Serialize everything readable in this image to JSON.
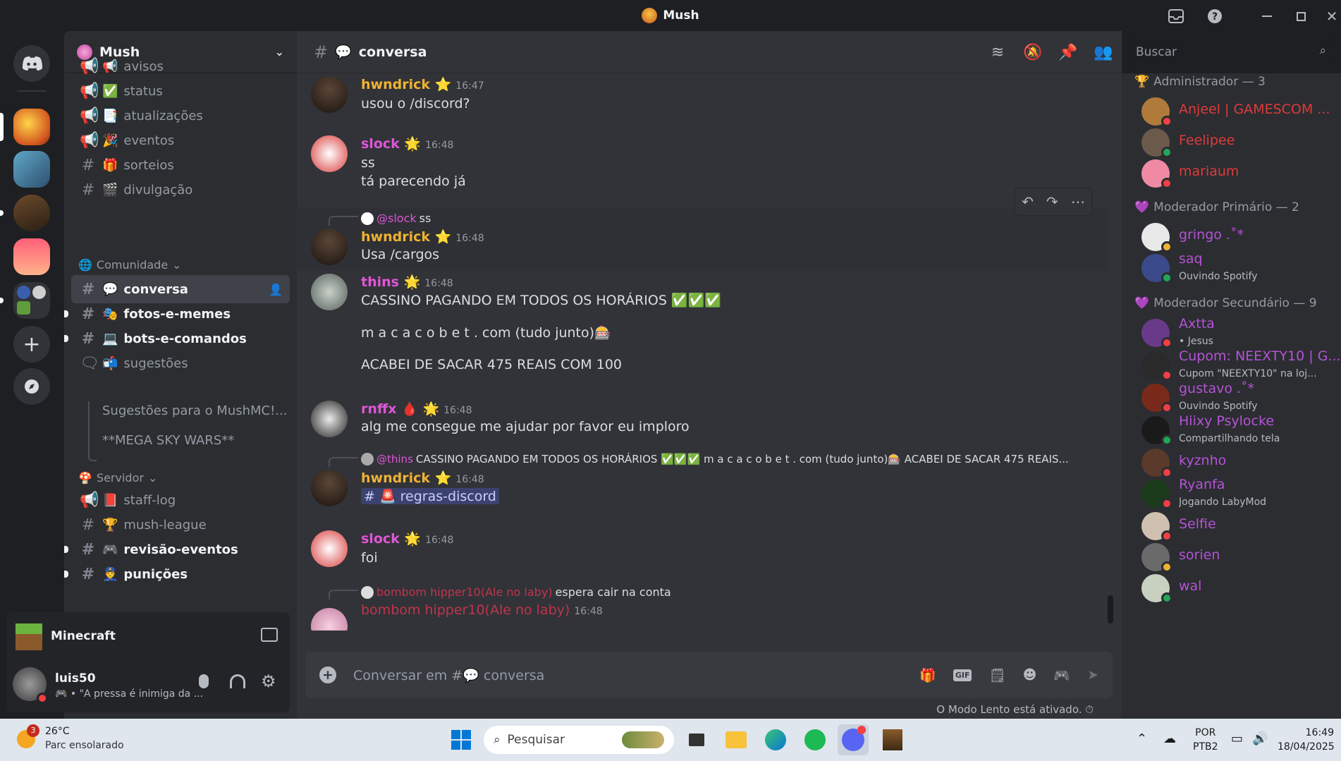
{
  "window": {
    "title": "Mush"
  },
  "server": {
    "name": "Mush"
  },
  "channels": [
    {
      "icon": "📢",
      "name": "avisos",
      "type": "announce",
      "bold": false
    },
    {
      "icon": "✅",
      "name": "status",
      "type": "announce",
      "bold": false
    },
    {
      "icon": "📑",
      "name": "atualizações",
      "type": "announce",
      "bold": false
    },
    {
      "icon": "🎉",
      "name": "eventos",
      "type": "announce",
      "bold": false
    },
    {
      "icon": "🎁",
      "name": "sorteios",
      "type": "text",
      "bold": false
    },
    {
      "icon": "🎬",
      "name": "divulgação",
      "type": "text",
      "bold": false
    }
  ],
  "category_comunidade": "Comunidade",
  "community_channels": [
    {
      "icon": "💬",
      "name": "conversa",
      "bold": true,
      "active": true
    },
    {
      "icon": "🎭",
      "name": "fotos-e-memes",
      "bold": true
    },
    {
      "icon": "💻",
      "name": "bots-e-comandos",
      "bold": true
    },
    {
      "icon": "📬",
      "name": "sugestões",
      "bold": false
    }
  ],
  "threads": [
    "Sugestões para o MushMC!...",
    "**MEGA SKY WARS**"
  ],
  "category_servidor": "Servidor",
  "server_channels": [
    {
      "icon": "📕",
      "name": "staff-log",
      "type": "announce",
      "bold": false
    },
    {
      "icon": "🏆",
      "name": "mush-league",
      "type": "text",
      "bold": false
    },
    {
      "icon": "🎮",
      "name": "revisão-eventos",
      "type": "text",
      "bold": true
    },
    {
      "icon": "👮",
      "name": "punições",
      "type": "text",
      "bold": true
    }
  ],
  "activity": {
    "game": "Minecraft"
  },
  "user": {
    "name": "luis50",
    "status": "\"A pressa é inimiga da ..."
  },
  "header": {
    "channel": "conversa",
    "search_placeholder": "Buscar"
  },
  "messages": [
    {
      "user": "hwndrick",
      "time": "16:47",
      "lines": [
        "usou o /discord?"
      ]
    },
    {
      "user": "slock",
      "time": "16:48",
      "lines": [
        "ss",
        "tá parecendo já"
      ]
    },
    {
      "reply_user": "@slock",
      "reply_text": "ss",
      "user": "hwndrick",
      "time": "16:48",
      "lines": [
        "Usa /cargos"
      ]
    },
    {
      "user": "thins",
      "time": "16:48",
      "lines": [
        "CASSINO PAGANDO EM TODOS OS HORÁRIOS ✅✅✅",
        "m a c a c o b e t . com (tudo junto)🎰",
        "ACABEI DE SACAR 475 REAIS COM 100"
      ]
    },
    {
      "user": "rnffx",
      "time": "16:48",
      "lines": [
        "alg me consegue me ajudar por favor eu imploro"
      ]
    },
    {
      "reply_user": "@thins",
      "reply_text": "CASSINO PAGANDO EM TODOS OS HORÁRIOS ✅✅✅  m a c a c o b e t . com (tudo junto)🎰  ACABEI DE SACAR 475 REAIS...",
      "user": "hwndrick",
      "time": "16:48",
      "mention": "🚨 regras-discord"
    },
    {
      "user": "slock",
      "time": "16:48",
      "lines": [
        "foi"
      ]
    },
    {
      "reply_user": "bombom hipper10(Ale no laby)",
      "reply_text": "espera cair na conta",
      "user": "bombom hipper10(Ale no laby)",
      "time": "16:48"
    }
  ],
  "composer": {
    "placeholder": "Conversar em #💬 conversa",
    "slowmode": "O Modo Lento está ativado."
  },
  "member_groups": [
    {
      "title": "Administrador — 3",
      "members": [
        {
          "name": "Anjeel | GAMESCOM ...",
          "color": "#e03a3a",
          "sub": ""
        },
        {
          "name": "Feelipee",
          "color": "#e03a3a",
          "sub": ""
        },
        {
          "name": "mariaum",
          "color": "#e03a3a",
          "sub": ""
        }
      ]
    },
    {
      "title": "Moderador Primário — 2",
      "members": [
        {
          "name": "gringo .˚*",
          "color": "#b553d6",
          "sub": ""
        },
        {
          "name": "saq",
          "color": "#b553d6",
          "sub": "Ouvindo Spotify"
        }
      ]
    },
    {
      "title": "Moderador Secundário — 9",
      "members": [
        {
          "name": "Axtta",
          "color": "#b553d6",
          "sub": "• Jesus"
        },
        {
          "name": "Cupom: NEEXTY10 | G...",
          "color": "#b553d6",
          "sub": "Cupom \"NEEXTY10\" na loj..."
        },
        {
          "name": "gustavo .˚*",
          "color": "#b553d6",
          "sub": "Ouvindo Spotify"
        },
        {
          "name": "Hiixy Psylocke",
          "color": "#b553d6",
          "sub": "Compartilhando tela"
        },
        {
          "name": "kyznho",
          "color": "#b553d6",
          "sub": ""
        },
        {
          "name": "Ryanfa",
          "color": "#b553d6",
          "sub": "Jogando LabyMod"
        },
        {
          "name": "Selfie",
          "color": "#b553d6",
          "sub": ""
        },
        {
          "name": "sorien",
          "color": "#b553d6",
          "sub": ""
        },
        {
          "name": "wal",
          "color": "#b553d6",
          "sub": ""
        }
      ]
    }
  ],
  "taskbar": {
    "weather_temp": "26°C",
    "weather_desc": "Parc ensolarado",
    "weather_badge": "3",
    "search_placeholder": "Pesquisar",
    "lang1": "POR",
    "lang2": "PTB2",
    "time": "16:49",
    "date": "18/04/2025"
  }
}
